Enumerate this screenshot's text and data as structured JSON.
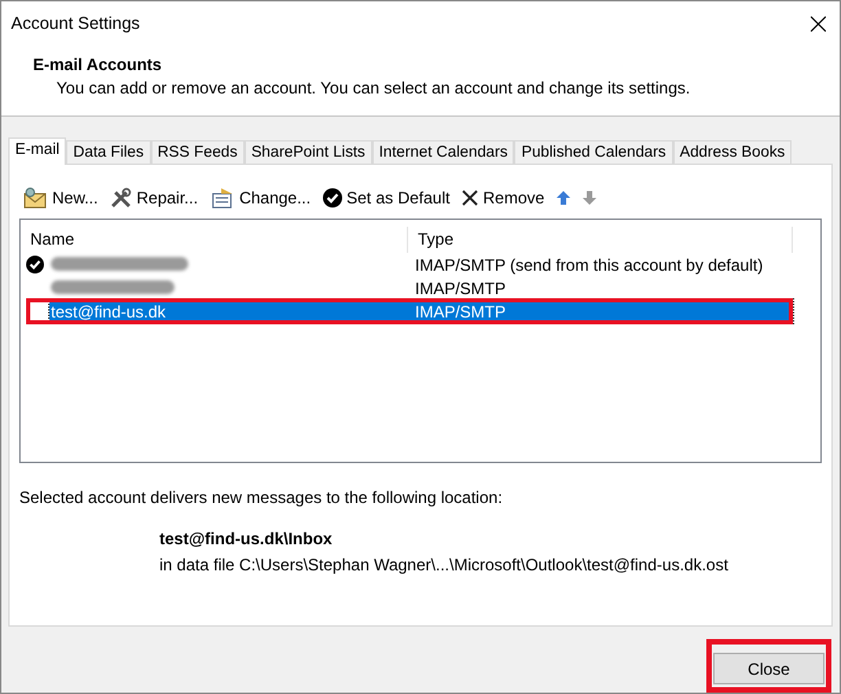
{
  "window": {
    "title": "Account Settings"
  },
  "header": {
    "title": "E-mail Accounts",
    "description": "You can add or remove an account. You can select an account and change its settings."
  },
  "tabs": [
    {
      "label": "E-mail",
      "selected": true
    },
    {
      "label": "Data Files",
      "selected": false
    },
    {
      "label": "RSS Feeds",
      "selected": false
    },
    {
      "label": "SharePoint Lists",
      "selected": false
    },
    {
      "label": "Internet Calendars",
      "selected": false
    },
    {
      "label": "Published Calendars",
      "selected": false
    },
    {
      "label": "Address Books",
      "selected": false
    }
  ],
  "toolbar": [
    {
      "kind": "new",
      "label": "New...",
      "disabled": false
    },
    {
      "kind": "repair",
      "label": "Repair...",
      "disabled": false
    },
    {
      "kind": "change",
      "label": "Change...",
      "disabled": false
    },
    {
      "kind": "default",
      "label": "Set as Default",
      "disabled": false
    },
    {
      "kind": "remove",
      "label": "Remove",
      "disabled": false
    },
    {
      "kind": "up",
      "disabled": false
    },
    {
      "kind": "down",
      "disabled": true
    }
  ],
  "table": {
    "columns": [
      "Name",
      "Type"
    ],
    "rows": [
      {
        "name": "",
        "redacted": true,
        "is_default": true,
        "type": "IMAP/SMTP (send from this account by default)",
        "selected": false,
        "annotated": false
      },
      {
        "name": "",
        "redacted": true,
        "is_default": false,
        "type": "IMAP/SMTP",
        "selected": false,
        "annotated": false
      },
      {
        "name": "test@find-us.dk",
        "redacted": false,
        "is_default": false,
        "type": "IMAP/SMTP",
        "selected": true,
        "annotated": true
      }
    ]
  },
  "delivery": {
    "label": "Selected account delivers new messages to the following location:",
    "folder": "test@find-us.dk\\Inbox",
    "data_file": "in data file C:\\Users\\Stephan Wagner\\...\\Microsoft\\Outlook\\test@find-us.dk.ost"
  },
  "close_button": {
    "label": "Close",
    "annotated": true
  }
}
